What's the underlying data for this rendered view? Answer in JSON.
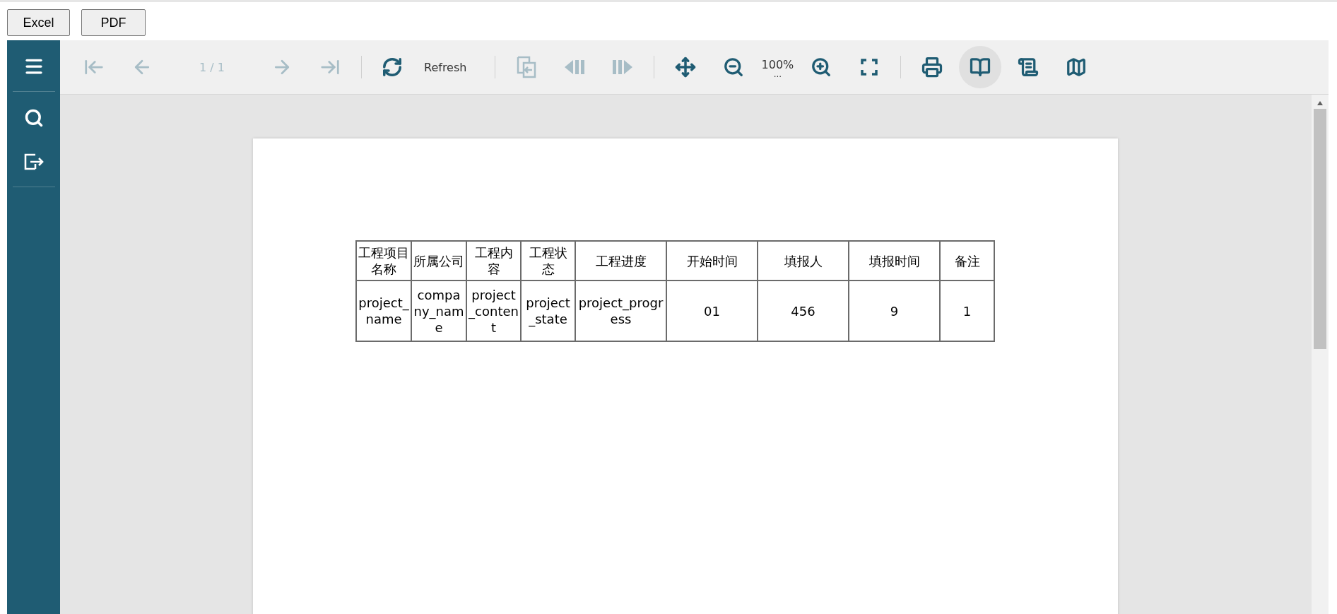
{
  "export_buttons": [
    "Excel",
    "PDF"
  ],
  "sidebar": {
    "items": [
      {
        "kind": "menu"
      },
      {
        "kind": "search"
      },
      {
        "kind": "export"
      }
    ]
  },
  "toolbar": [
    {
      "kind": "first",
      "disabled": true
    },
    {
      "kind": "prev",
      "disabled": true
    },
    {
      "kind": "page",
      "text": "1 / 1",
      "disabled": true
    },
    {
      "kind": "next",
      "disabled": true
    },
    {
      "kind": "last",
      "disabled": true
    },
    {
      "kind": "separator"
    },
    {
      "kind": "refresh",
      "text": "Refresh",
      "disabled": false
    },
    {
      "kind": "separator"
    },
    {
      "kind": "parent",
      "disabled": true
    },
    {
      "kind": "prev-section",
      "disabled": true
    },
    {
      "kind": "next-section",
      "disabled": true
    },
    {
      "kind": "separator"
    },
    {
      "kind": "pan",
      "disabled": false
    },
    {
      "kind": "zoom-out",
      "disabled": false
    },
    {
      "kind": "zoom",
      "text": "100%",
      "more": "..."
    },
    {
      "kind": "zoom-in",
      "disabled": false
    },
    {
      "kind": "fullscreen",
      "disabled": false
    },
    {
      "kind": "separator"
    },
    {
      "kind": "print",
      "disabled": false
    },
    {
      "kind": "book",
      "selected": true
    },
    {
      "kind": "scroll",
      "selected": false
    },
    {
      "kind": "galley",
      "selected": false
    }
  ],
  "table": {
    "columns": [
      "工程项目名称",
      "所属公司",
      "工程内容",
      "工程状态",
      "工程进度",
      "开始时间",
      "填报人",
      "填报时间",
      "备注"
    ],
    "rows": [
      [
        "project_name",
        "company_name",
        "project_content",
        "project_state",
        "project_progress",
        "01",
        "456",
        "9",
        "1"
      ]
    ]
  }
}
